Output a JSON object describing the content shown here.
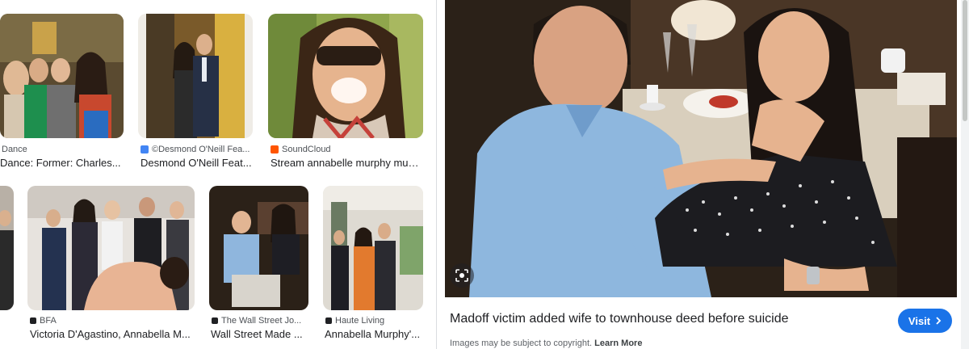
{
  "results": [
    {
      "source": "Dance",
      "caption": "Dance: Former: Charles...",
      "favicon_color": ""
    },
    {
      "source": "©Desmond O'Neill Fea...",
      "caption": "Desmond O'Neill Feat...",
      "favicon_color": "#4285f4"
    },
    {
      "source": "SoundCloud",
      "caption": "Stream annabelle murphy musi...",
      "favicon_color": "#ff5500"
    },
    {
      "source": "",
      "caption": "",
      "favicon_color": ""
    },
    {
      "source": "BFA",
      "caption": "Victoria D'Agastino, Annabella M...",
      "favicon_color": "#202124"
    },
    {
      "source": "The Wall Street Jo...",
      "caption": "Wall Street Made ...",
      "favicon_color": "#202124"
    },
    {
      "source": "Haute Living",
      "caption": "Annabella Murphy'...",
      "favicon_color": "#202124"
    }
  ],
  "preview": {
    "title": "Madoff victim added wife to townhouse deed before suicide",
    "visit_label": "Visit",
    "copyright_text": "Images may be subject to copyright.",
    "learn_more": "Learn More"
  },
  "icons": [
    "lens-icon",
    "chevron-right-icon",
    "favicon-icon"
  ]
}
